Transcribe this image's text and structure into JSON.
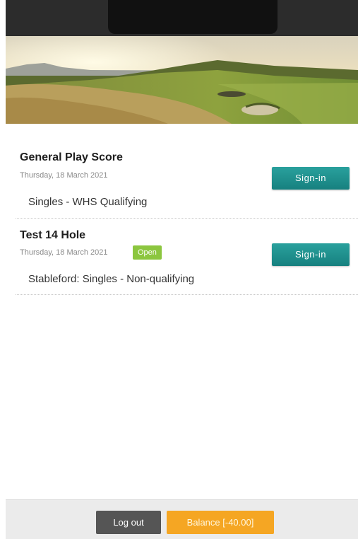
{
  "theme": {
    "accent": "#16807f",
    "badge_open": "#8cc63f",
    "balance": "#f5a623",
    "logout": "#555555"
  },
  "events": [
    {
      "title": "General Play Score",
      "date": "Thursday, 18 March 2021",
      "description": "Singles - WHS Qualifying",
      "button_label": "Sign-in"
    },
    {
      "title": "Test 14 Hole",
      "date": "Thursday, 18 March 2021",
      "badge": "Open",
      "description": "Stableford: Singles - Non-qualifying",
      "button_label": "Sign-in"
    }
  ],
  "footer": {
    "logout_label": "Log out",
    "balance_label": "Balance [-40.00]"
  }
}
